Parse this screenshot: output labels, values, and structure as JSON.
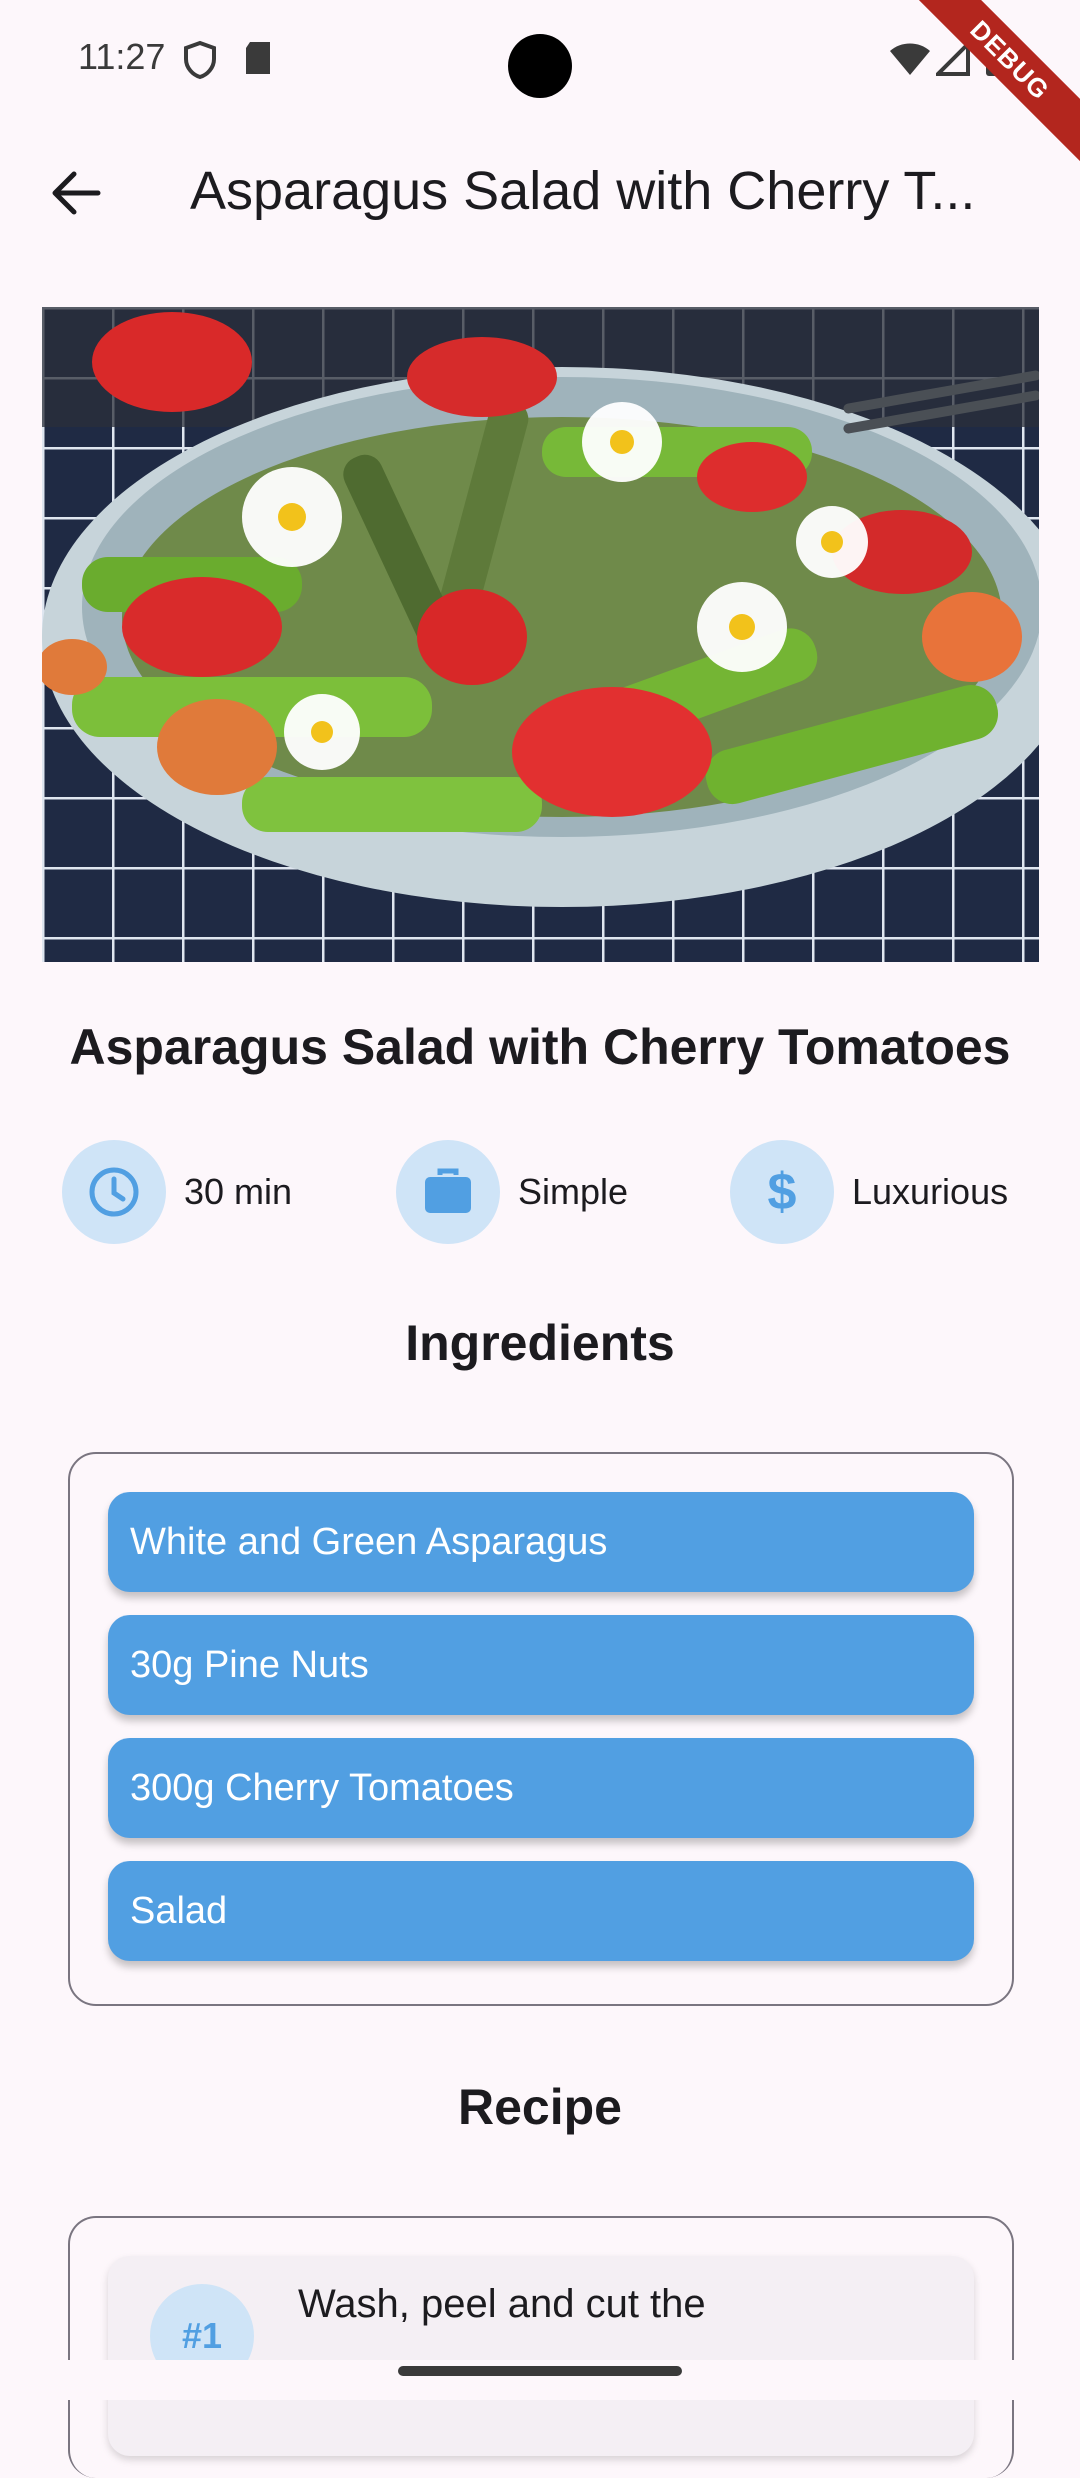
{
  "status_bar": {
    "time": "11:27",
    "debug_label": "DEBUG"
  },
  "app_bar": {
    "title": "Asparagus Salad with Cherry T..."
  },
  "recipe": {
    "title": "Asparagus Salad with Cherry Tomatoes",
    "duration": "30 min",
    "complexity": "Simple",
    "affordability": "Luxurious"
  },
  "sections": {
    "ingredients_title": "Ingredients",
    "recipe_title": "Recipe"
  },
  "ingredients": [
    "White and Green Asparagus",
    "30g Pine Nuts",
    "300g Cherry Tomatoes",
    "Salad"
  ],
  "steps": [
    {
      "number": "#1",
      "text": "Wash, peel and cut the"
    }
  ],
  "colors": {
    "accent": "#519fe2",
    "accent_light": "#cfe4f7",
    "background": "#fdf7fb"
  }
}
